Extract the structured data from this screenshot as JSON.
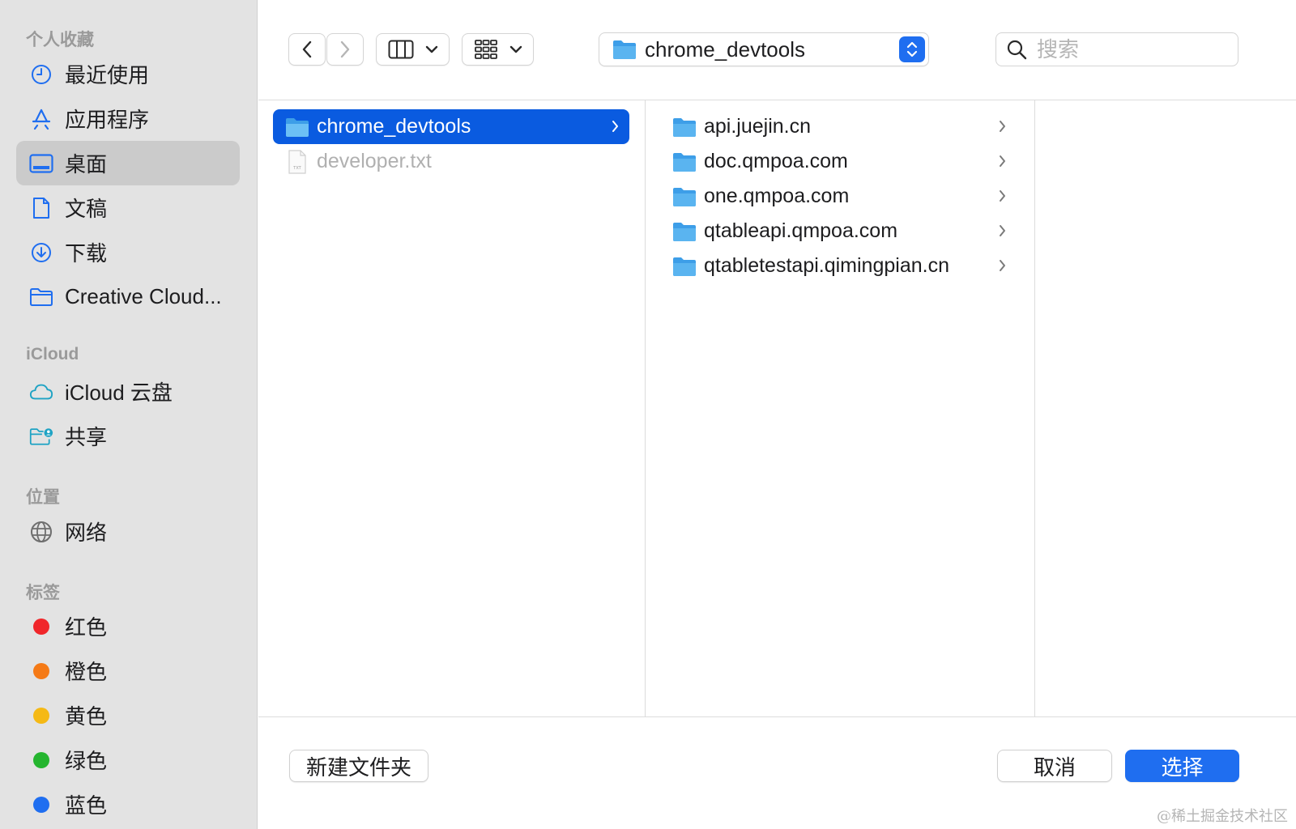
{
  "sidebar": {
    "sections": [
      {
        "title": "个人收藏"
      },
      {
        "title": "iCloud"
      },
      {
        "title": "位置"
      },
      {
        "title": "标签"
      }
    ],
    "favorites": [
      {
        "label": "最近使用",
        "icon": "clock-icon"
      },
      {
        "label": "应用程序",
        "icon": "app-store-icon"
      },
      {
        "label": "桌面",
        "icon": "desktop-icon",
        "selected": true
      },
      {
        "label": "文稿",
        "icon": "document-icon"
      },
      {
        "label": "下载",
        "icon": "download-icon"
      },
      {
        "label": "Creative Cloud...",
        "icon": "folder-icon"
      }
    ],
    "icloud": [
      {
        "label": "iCloud 云盘",
        "icon": "cloud-icon"
      },
      {
        "label": "共享",
        "icon": "shared-folder-icon"
      }
    ],
    "locations": [
      {
        "label": "网络",
        "icon": "globe-icon"
      }
    ],
    "tags": [
      {
        "label": "红色",
        "color": "#f0262a"
      },
      {
        "label": "橙色",
        "color": "#f57a16"
      },
      {
        "label": "黄色",
        "color": "#f5b915"
      },
      {
        "label": "绿色",
        "color": "#25b52f"
      },
      {
        "label": "蓝色",
        "color": "#1f6ef0"
      }
    ]
  },
  "toolbar": {
    "path_label": "chrome_devtools",
    "search_placeholder": "搜索"
  },
  "columns": {
    "col1": [
      {
        "label": "chrome_devtools",
        "type": "folder",
        "selected": true
      },
      {
        "label": "developer.txt",
        "type": "file",
        "dim": true
      }
    ],
    "col2": [
      {
        "label": "api.juejin.cn",
        "type": "folder"
      },
      {
        "label": "doc.qmpoa.com",
        "type": "folder"
      },
      {
        "label": "one.qmpoa.com",
        "type": "folder"
      },
      {
        "label": "qtableapi.qmpoa.com",
        "type": "folder"
      },
      {
        "label": "qtabletestapi.qimingpian.cn",
        "type": "folder"
      }
    ]
  },
  "footer": {
    "new_folder_label": "新建文件夹",
    "cancel_label": "取消",
    "choose_label": "选择"
  },
  "watermark": "@稀土掘金技术社区",
  "colors": {
    "accent": "#1f6ef0",
    "selection": "#0a5be0",
    "folder_blue": "#5ab4f0"
  }
}
